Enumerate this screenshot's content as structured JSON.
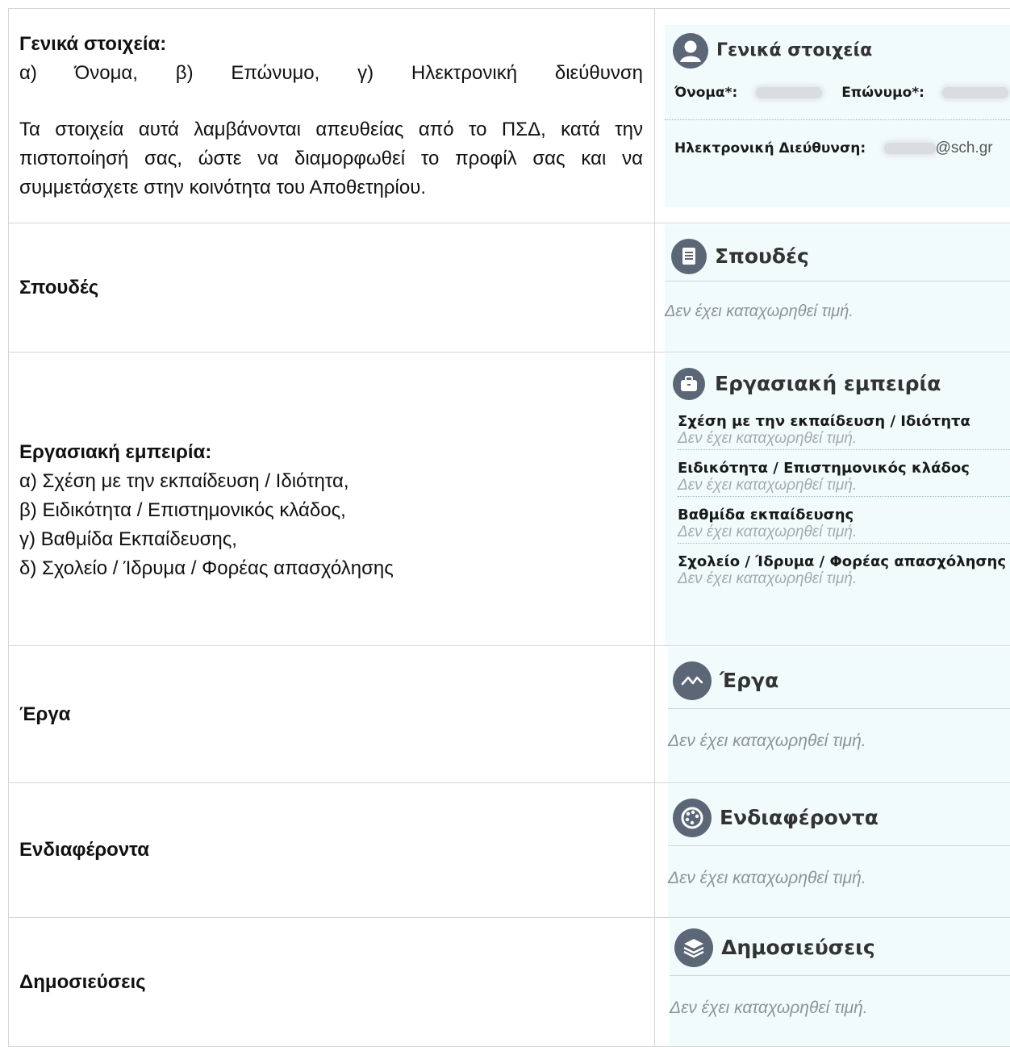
{
  "rows": {
    "general": {
      "left_title": "Γενικά στοιχεία:",
      "left_line": "α)  Όνομα,  β)  Επώνυμο,  γ)  Ηλεκτρονική  διεύθυνση",
      "left_para": "Τα στοιχεία αυτά λαμβάνονται απευθείας από το ΠΣΔ, κατά την πιστοποίησή σας, ώστε να διαμορφωθεί το προφίλ σας και να συμμετάσχετε στην κοινότητα του Αποθετηρίου.",
      "panel_title": "Γενικά στοιχεία",
      "icon": "user-icon",
      "name_label": "Όνομα*:",
      "surname_label": "Επώνυμο*:",
      "email_label": "Ηλεκτρονική Διεύθυνση:",
      "email_suffix": "@sch.gr"
    },
    "studies": {
      "left_title": "Σπουδές",
      "panel_title": "Σπουδές",
      "icon": "document-icon",
      "empty": "Δεν έχει καταχωρηθεί τιμή."
    },
    "work": {
      "left_title": "Εργασιακή εμπειρία:",
      "left_lines": [
        "α) Σχέση με την εκπαίδευση / Ιδιότητα,",
        "β) Ειδικότητα / Επιστημονικός κλάδος,",
        "γ) Βαθμίδα Εκπαίδευσης,",
        "δ) Σχολείο / Ίδρυμα / Φορέας απασχόλησης"
      ],
      "panel_title": "Εργασιακή εμπειρία",
      "icon": "briefcase-icon",
      "fields": [
        {
          "label": "Σχέση με την εκπαίδευση / Ιδιότητα",
          "value": "Δεν έχει καταχωρηθεί τιμή."
        },
        {
          "label": "Ειδικότητα / Επιστημονικός κλάδος",
          "value": "Δεν έχει καταχωρηθεί τιμή."
        },
        {
          "label": "Βαθμίδα εκπαίδευσης",
          "value": "Δεν έχει καταχωρηθεί τιμή."
        },
        {
          "label": "Σχολείο / Ίδρυμα / Φορέας απασχόλησης",
          "value": "Δεν έχει καταχωρηθεί τιμή."
        }
      ]
    },
    "projects": {
      "left_title": "Έργα",
      "panel_title": "Έργα",
      "icon": "activity-icon",
      "empty": "Δεν έχει καταχωρηθεί τιμή."
    },
    "interests": {
      "left_title": "Ενδιαφέροντα",
      "panel_title": "Ενδιαφέροντα",
      "icon": "palette-icon",
      "empty": "Δεν έχει καταχωρηθεί τιμή."
    },
    "publications": {
      "left_title": "Δημοσιεύσεις",
      "panel_title": "Δημοσιεύσεις",
      "icon": "layers-icon",
      "empty": "Δεν έχει καταχωρηθεί τιμή."
    }
  },
  "colors": {
    "panel_bg": "#f2fbfb",
    "icon_bg": "#5b6676",
    "muted": "#8b939a",
    "dotted": "#9bc0cf"
  }
}
